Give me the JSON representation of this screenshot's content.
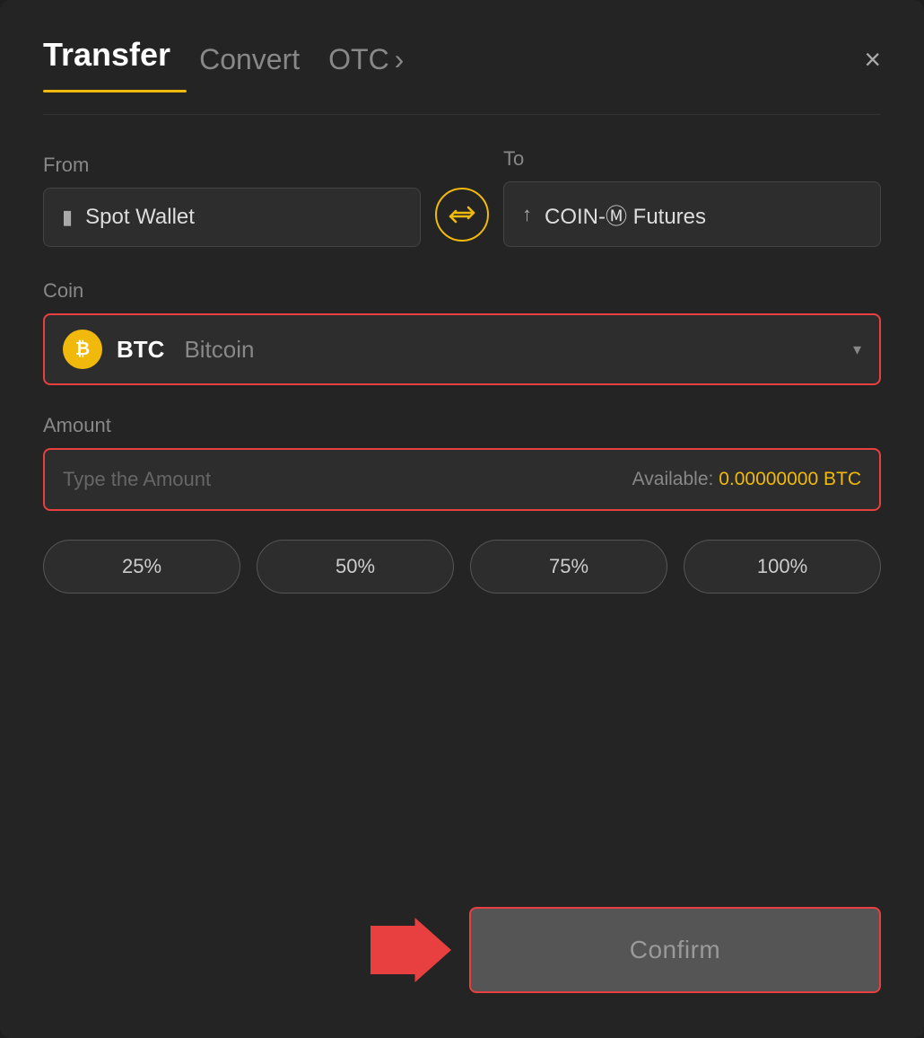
{
  "header": {
    "tab_transfer": "Transfer",
    "tab_convert": "Convert",
    "tab_otc": "OTC",
    "tab_otc_chevron": "›",
    "close_label": "×"
  },
  "from": {
    "label": "From",
    "wallet_icon": "▬",
    "wallet_text": "Spot Wallet"
  },
  "to": {
    "label": "To",
    "wallet_icon": "↑",
    "wallet_text": "COIN-Ⓜ Futures"
  },
  "swap": {
    "icon": "⇄"
  },
  "coin": {
    "label": "Coin",
    "symbol": "BTC",
    "name": "Bitcoin",
    "chevron": "▾"
  },
  "amount": {
    "label": "Amount",
    "placeholder": "Type the Amount",
    "available_label": "Available:",
    "available_value": "0.00000000 BTC"
  },
  "percentage_buttons": [
    {
      "label": "25%"
    },
    {
      "label": "50%"
    },
    {
      "label": "75%"
    },
    {
      "label": "100%"
    }
  ],
  "confirm": {
    "label": "Confirm"
  },
  "colors": {
    "accent": "#f0b90b",
    "red": "#e84040",
    "bg": "#242424",
    "surface": "#2d2d2d"
  }
}
